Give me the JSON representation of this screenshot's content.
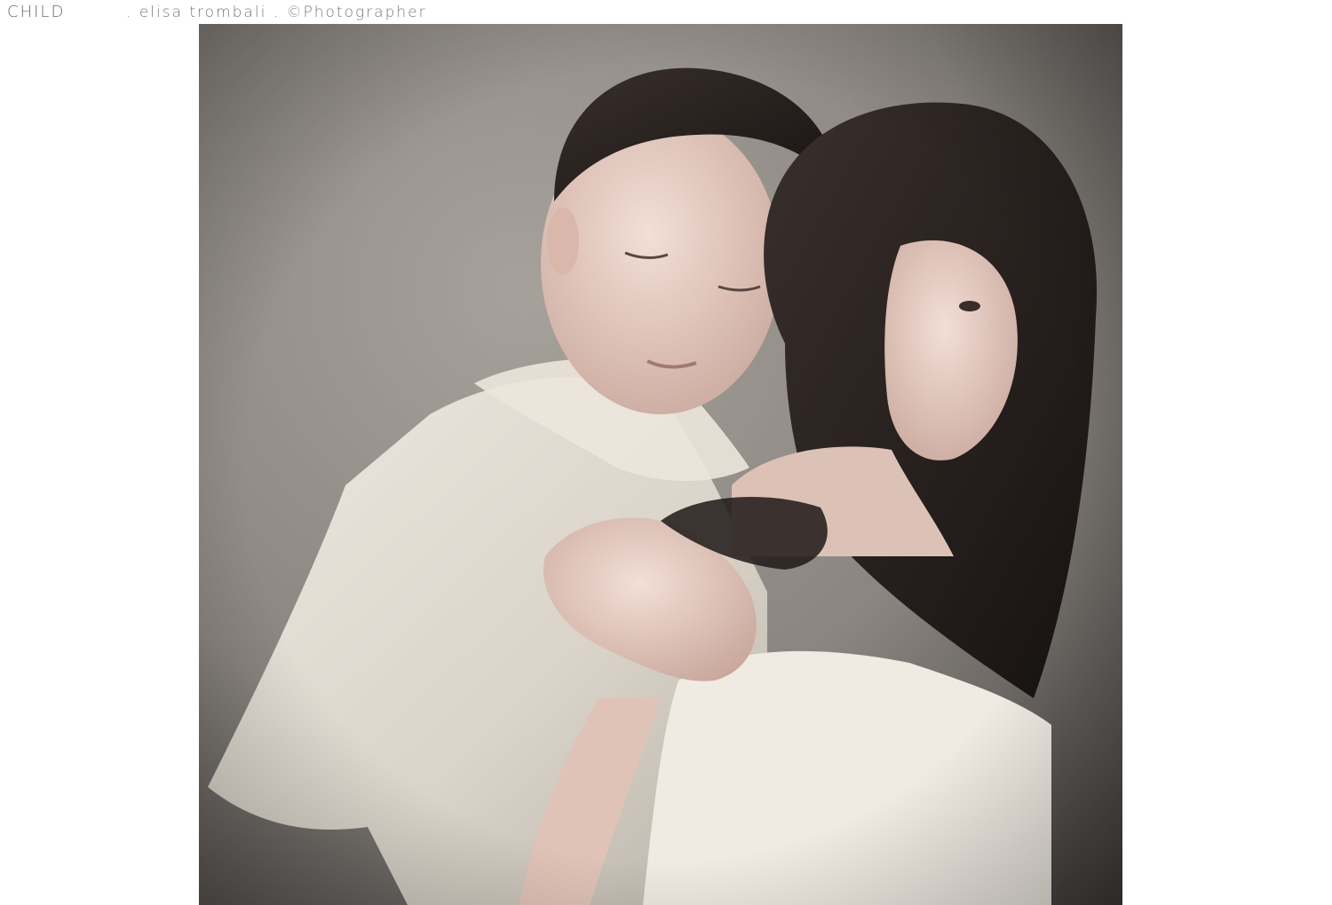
{
  "header": {
    "section_title": "CHILD",
    "credit_text": ". elisa trombali . ©Photographer"
  },
  "photo": {
    "subject": "photograph",
    "colors": {
      "wall_light": "#9a958f",
      "wall_dark": "#4a4744",
      "fabric": "#e4dfd6",
      "skin": "#e9cfc4",
      "hair": "#2a2321"
    }
  }
}
